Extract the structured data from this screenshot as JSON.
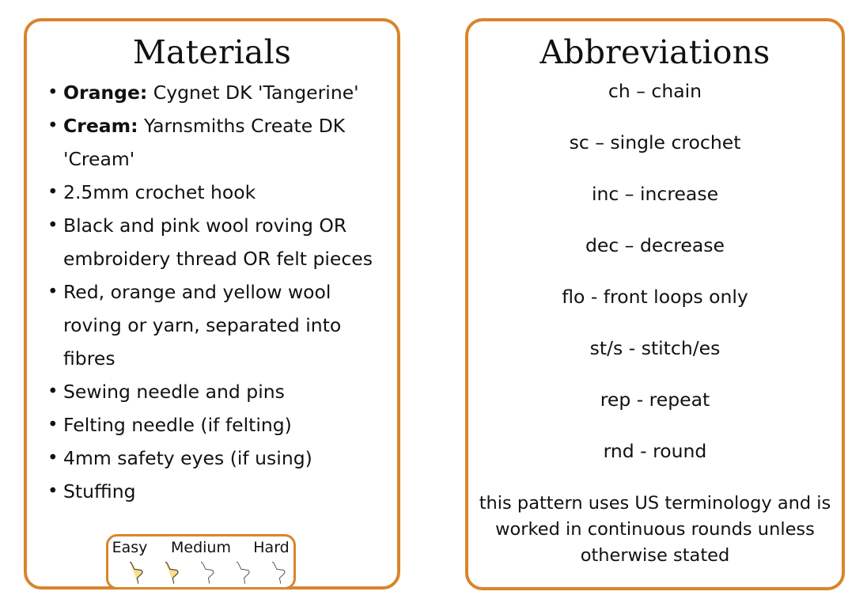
{
  "materials": {
    "title": "Materials",
    "items": [
      {
        "label": "Orange:",
        "text": " Cygnet DK 'Tangerine'"
      },
      {
        "label": "Cream:",
        "text": " Yarnsmiths Create DK 'Cream'"
      },
      {
        "label": "",
        "text": "2.5mm crochet hook"
      },
      {
        "label": "",
        "text": "Black and pink wool roving OR embroidery thread OR felt pieces"
      },
      {
        "label": "",
        "text": "Red, orange and yellow wool roving or yarn, separated into fibres"
      },
      {
        "label": "",
        "text": "Sewing needle and pins"
      },
      {
        "label": "",
        "text": "Felting needle (if felting)"
      },
      {
        "label": "",
        "text": "4mm safety eyes (if using)"
      },
      {
        "label": "",
        "text": "Stuffing"
      }
    ],
    "rating": {
      "easy_label": "Easy",
      "medium_label": "Medium",
      "hard_label": "Hard",
      "total_stars": 5,
      "filled_stars": 2,
      "filled_color": "#fcde85",
      "empty_color": "#ffffff",
      "outline_color": "#3a3a3a"
    }
  },
  "abbreviations": {
    "title": "Abbreviations",
    "items": [
      "ch – chain",
      "sc – single crochet",
      "inc – increase",
      "dec – decrease",
      "flo - front loops only",
      "st/s - stitch/es",
      "rep - repeat",
      "rnd - round"
    ],
    "note": "this pattern uses US terminology and is worked in continuous rounds unless otherwise stated"
  },
  "theme": {
    "border_color": "#d8852b",
    "background": "#ffffff",
    "text_color": "#111111"
  }
}
